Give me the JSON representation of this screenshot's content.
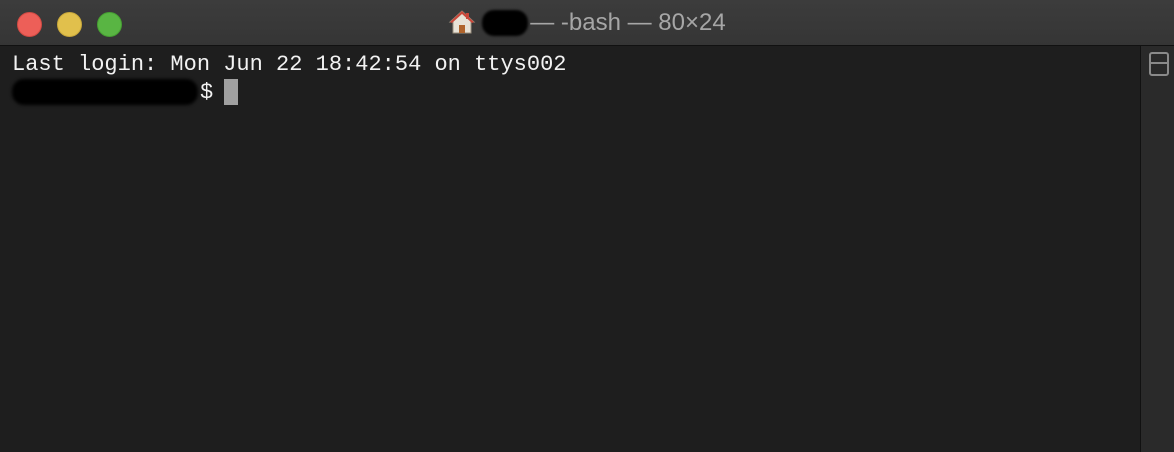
{
  "window": {
    "title_suffix": "— -bash — 80×24",
    "title_icon": "home-icon",
    "traffic_lights": {
      "close": "#ed5f58",
      "minimize": "#e1c04c",
      "zoom": "#59b543"
    }
  },
  "terminal": {
    "last_login": "Last login: Mon Jun 22 18:42:54 on ttys002",
    "prompt_suffix": "$",
    "background": "#1e1e1e",
    "text_color": "#f2f2f2"
  },
  "scrollbar": {
    "split_button_icon": "split-pane-icon"
  }
}
